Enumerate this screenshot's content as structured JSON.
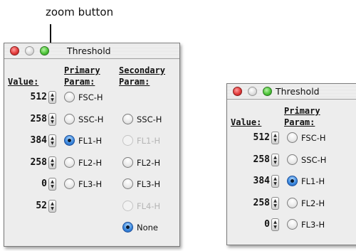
{
  "annotation": {
    "label": "zoom button"
  },
  "window_large": {
    "title": "Threshold",
    "headers": {
      "value": "Value:",
      "primary_line1": "Primary",
      "primary_line2": "Param:",
      "secondary_line1": "Secondary",
      "secondary_line2": "Param:"
    },
    "rows": [
      {
        "value": "512",
        "primary": {
          "label": "FSC-H",
          "state": "off"
        },
        "secondary": null
      },
      {
        "value": "258",
        "primary": {
          "label": "SSC-H",
          "state": "off"
        },
        "secondary": {
          "label": "SSC-H",
          "state": "off"
        }
      },
      {
        "value": "384",
        "primary": {
          "label": "FL1-H",
          "state": "selected"
        },
        "secondary": {
          "label": "FL1-H",
          "state": "disabled"
        }
      },
      {
        "value": "258",
        "primary": {
          "label": "FL2-H",
          "state": "off"
        },
        "secondary": {
          "label": "FL2-H",
          "state": "off"
        }
      },
      {
        "value": "0",
        "primary": {
          "label": "FL3-H",
          "state": "off"
        },
        "secondary": {
          "label": "FL3-H",
          "state": "off"
        }
      },
      {
        "value": "52",
        "primary": null,
        "secondary": {
          "label": "FL4-H",
          "state": "disabled"
        }
      },
      {
        "value": null,
        "primary": null,
        "secondary": {
          "label": "None",
          "state": "selected"
        }
      }
    ]
  },
  "window_small": {
    "title": "Threshold",
    "headers": {
      "value": "Value:",
      "primary_line1": "Primary",
      "primary_line2": "Param:"
    },
    "rows": [
      {
        "value": "512",
        "primary": {
          "label": "FSC-H",
          "state": "off"
        }
      },
      {
        "value": "258",
        "primary": {
          "label": "SSC-H",
          "state": "off"
        }
      },
      {
        "value": "384",
        "primary": {
          "label": "FL1-H",
          "state": "selected"
        }
      },
      {
        "value": "258",
        "primary": {
          "label": "FL2-H",
          "state": "off"
        }
      },
      {
        "value": "0",
        "primary": {
          "label": "FL3-H",
          "state": "off"
        }
      }
    ]
  },
  "colors": {
    "selected_radio": "#3d8be0",
    "close_button": "#e33c3c",
    "zoom_button": "#4fc63a"
  }
}
